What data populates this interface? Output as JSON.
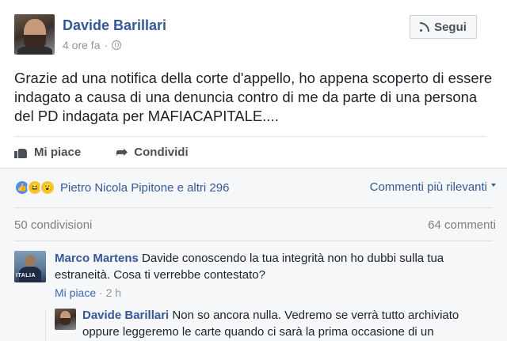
{
  "post": {
    "author": "Davide Barillari",
    "time": "4 ore fa",
    "time_separator": "·",
    "follow_label": "Segui",
    "text": "Grazie ad una notifica della corte d'appello, ho appena scoperto di essere indagato a causa di una denuncia contro di me da parte di una persona del PD indagata per MAFIACAPITALE...."
  },
  "actions": {
    "like_label": "Mi piace",
    "share_label": "Condividi"
  },
  "reactions": {
    "icons": [
      "like",
      "haha",
      "wow"
    ],
    "names": "Pietro Nicola Pipitone e altri 296",
    "sort_label": "Commenti più rilevanti"
  },
  "stats": {
    "shares": "50 condivisioni",
    "comments": "64 commenti"
  },
  "comments": [
    {
      "author": "Marco Martens",
      "text": "Davide conoscendo la tua integrità non ho dubbi sulla tua estraneità. Cosa ti verrebbe contestato?",
      "like_label": "Mi piace",
      "separator": "·",
      "time": "2 h",
      "avatar_badge": "ITALIA"
    },
    {
      "author": "Davide Barillari",
      "text": "Non so ancora nulla. Vedremo se verrà tutto archiviato oppure leggeremo le carte quando ci sarà la prima occasione di un"
    }
  ],
  "colors": {
    "link": "#365899",
    "text": "#1d2129",
    "muted": "#90949c",
    "like_reaction": "#4f8cf7",
    "emoji_reaction": "#f7c52f"
  }
}
